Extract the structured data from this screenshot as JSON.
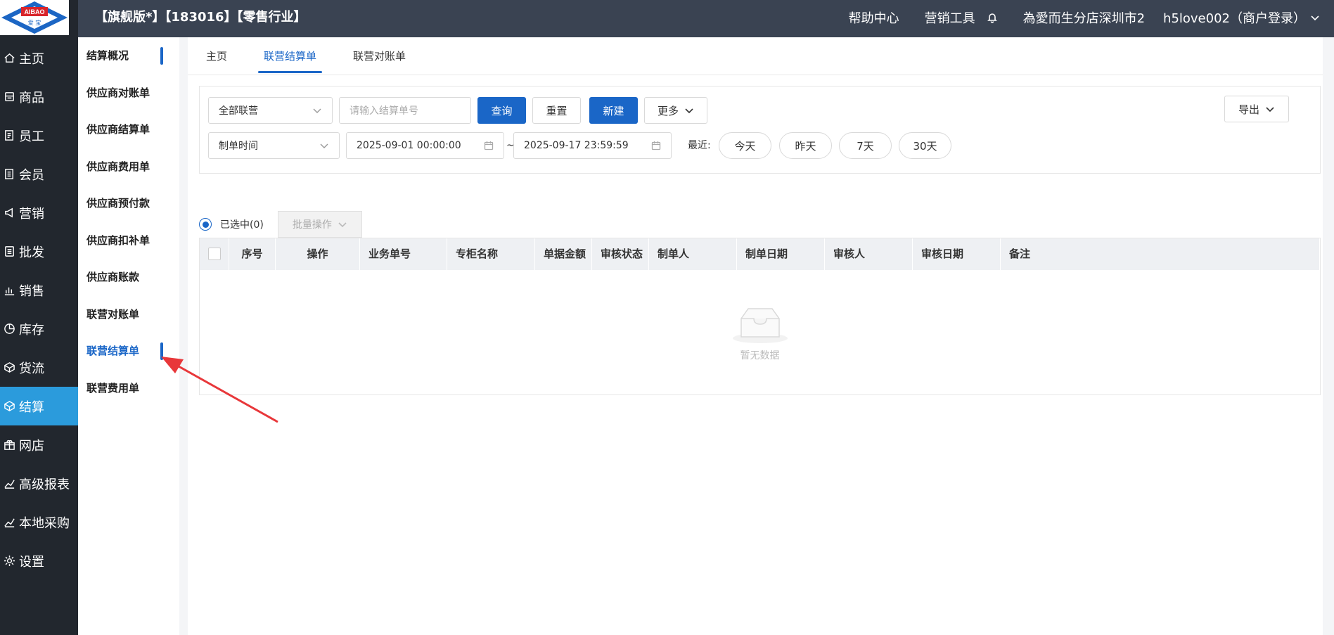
{
  "logo": {
    "text_top": "AIBAO",
    "text_bottom": "爱 宝"
  },
  "header": {
    "title": "【旗舰版*】【183016】【零售行业】",
    "help": "帮助中心",
    "marketing_tools": "营销工具",
    "store": "為愛而生分店深圳市2",
    "user": "h5love002（商户登录）"
  },
  "nav": {
    "items": [
      {
        "label": "主页",
        "icon": "home-icon"
      },
      {
        "label": "商品",
        "icon": "goods-icon"
      },
      {
        "label": "员工",
        "icon": "staff-icon"
      },
      {
        "label": "会员",
        "icon": "member-icon"
      },
      {
        "label": "营销",
        "icon": "megaphone-icon"
      },
      {
        "label": "批发",
        "icon": "list-icon"
      },
      {
        "label": "销售",
        "icon": "chart-icon"
      },
      {
        "label": "库存",
        "icon": "pie-icon"
      },
      {
        "label": "货流",
        "icon": "box-icon"
      },
      {
        "label": "结算",
        "icon": "box-icon",
        "active": true
      },
      {
        "label": "网店",
        "icon": "gift-icon"
      },
      {
        "label": "高级报表",
        "icon": "trend-icon"
      },
      {
        "label": "本地采购",
        "icon": "trend-icon"
      },
      {
        "label": "设置",
        "icon": "gear-icon"
      }
    ]
  },
  "submenu": {
    "items": [
      {
        "label": "结算概况"
      },
      {
        "label": "供应商对账单"
      },
      {
        "label": "供应商结算单"
      },
      {
        "label": "供应商费用单"
      },
      {
        "label": "供应商预付款"
      },
      {
        "label": "供应商扣补单"
      },
      {
        "label": "供应商账款"
      },
      {
        "label": "联营对账单"
      },
      {
        "label": "联营结算单",
        "active": true
      },
      {
        "label": "联营费用单"
      }
    ]
  },
  "tabs": [
    "主页",
    "联营结算单",
    "联营对账单"
  ],
  "filters": {
    "joint_select": "全部联营",
    "order_no_placeholder": "请输入结算单号",
    "query": "查询",
    "reset": "重置",
    "new": "新建",
    "more": "更多",
    "export": "导出",
    "time_type": "制单时间",
    "start": "2025-09-01 00:00:00",
    "tilde": "~",
    "end": "2025-09-17 23:59:59",
    "recent_label": "最近:",
    "today": "今天",
    "yesterday": "昨天",
    "days7": "7天",
    "days30": "30天"
  },
  "selection": {
    "selected": "已选中(0)",
    "batch": "批量操作"
  },
  "table": {
    "columns": [
      "序号",
      "操作",
      "业务单号",
      "专柜名称",
      "单据金额",
      "审核状态",
      "制单人",
      "制单日期",
      "审核人",
      "审核日期",
      "备注"
    ],
    "empty": "暂无数据"
  },
  "colors": {
    "primary": "#1a66c7",
    "nav_bg": "#22272e",
    "nav_active": "#2b9bdc",
    "topbar": "#3a4352",
    "annotation_arrow": "#e8373a"
  }
}
